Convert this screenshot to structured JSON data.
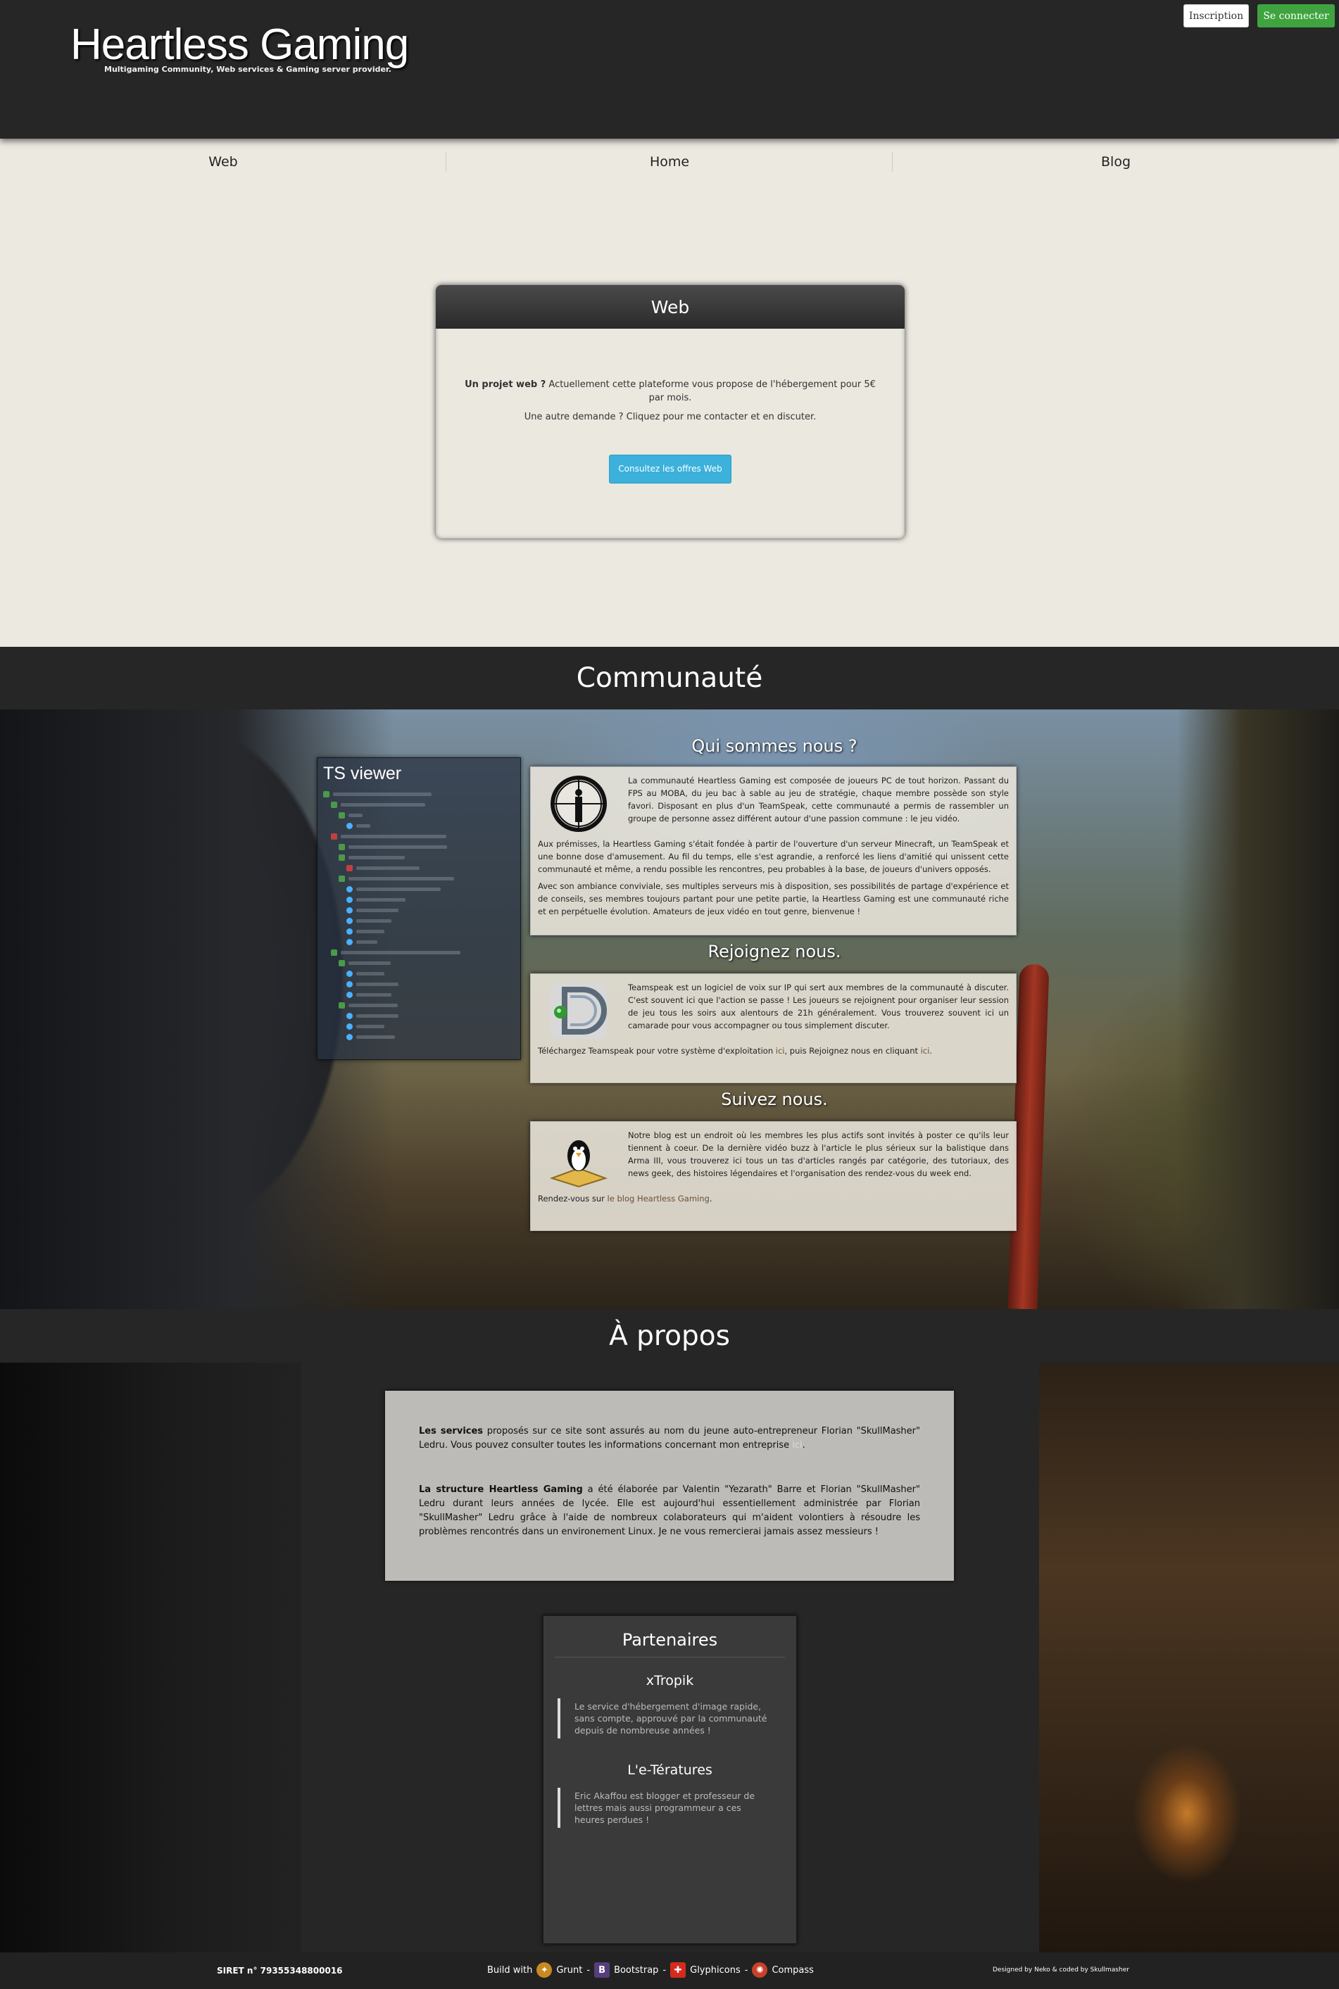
{
  "header": {
    "brand": "Heartless Gaming",
    "tagline": "Multigaming Community, Web services & Gaming server provider.",
    "signup_label": "Inscription",
    "login_label": "Se connecter"
  },
  "nav": {
    "items": [
      {
        "label": "Web"
      },
      {
        "label": "Home"
      },
      {
        "label": "Blog"
      }
    ]
  },
  "web": {
    "title": "Web",
    "line1_bold": "Un projet web ?",
    "line1": " Actuellement cette plateforme vous propose de l'hébergement pour 5€ par mois.",
    "line2": "Une autre demande ? Cliquez pour me contacter et en discuter.",
    "button_label": "Consultez les offres Web"
  },
  "community": {
    "title": "Communauté",
    "ts_viewer_title": "TS viewer",
    "about": {
      "title": "Qui sommes nous ?",
      "p1": "La communauté Heartless Gaming est composée de joueurs PC de tout horizon. Passant du FPS au MOBA, du jeu bac à sable au jeu de stratégie, chaque membre possède son style favori. Disposant en plus d'un TeamSpeak, cette communauté a permis de rassembler un groupe de personne assez différent autour d'une passion commune : le jeu vidéo.",
      "p2": "Aux prémisses, la Heartless Gaming s'était fondée à partir de l'ouverture d'un serveur Minecraft, un TeamSpeak et une bonne dose d'amusement. Au fil du temps, elle s'est agrandie, a renforcé les liens d'amitié qui unissent cette communauté et même, a rendu possible les rencontres, peu probables à la base, de joueurs d'univers opposés.",
      "p3": "Avec son ambiance conviviale, ses multiples serveurs mis à disposition, ses possibilités de partage d'expérience et de conseils, ses membres toujours partant pour une petite partie, la Heartless Gaming est une communauté riche et en perpétuelle évolution. Amateurs de jeux vidéo en tout genre, bienvenue !"
    },
    "join": {
      "title": "Rejoignez nous.",
      "p1": "Teamspeak est un logiciel de voix sur IP qui sert aux membres de la communauté à discuter. C'est souvent ici que l'action se passe ! Les joueurs se rejoignent pour organiser leur session de jeu tous les soirs aux alentours de 21h généralement. Vous trouverez souvent ici un camarade pour vous accompagner ou tous simplement discuter.",
      "p2a": "Téléchargez Teamspeak pour votre système d'exploitation ",
      "p2_link1": "ici",
      "p2b": ", puis Rejoignez nous en cliquant ",
      "p2_link2": "ici",
      "p2c": "."
    },
    "follow": {
      "title": "Suivez nous.",
      "p1": "Notre blog est un endroit où les membres les plus actifs sont invités à poster ce qu'ils leur tiennent à coeur. De la dernière vidéo buzz à l'article le plus sérieux sur la balistique dans Arma III, vous trouverez ici tous un tas d'articles rangés par catégorie, des tutoriaux, des news geek, des histoires légendaires et l'organisation des rendez-vous du week end.",
      "p2a": "Rendez-vous sur ",
      "p2_link": "le blog Heartless Gaming",
      "p2b": "."
    }
  },
  "apropos": {
    "title": "À propos",
    "p1_bold": "Les services",
    "p1": " proposés sur ce site sont assurés au nom du jeune auto-entrepreneur Florian \"SkullMasher\" Ledru. Vous pouvez consulter toutes les informations concernant mon entreprise ",
    "p1_link": "ici",
    "p1_end": ".",
    "p2_bold": "La structure Heartless Gaming",
    "p2": " a été élaborée par Valentin \"Yezarath\" Barre et Florian \"SkullMasher\" Ledru durant leurs années de lycée. Elle est aujourd'hui essentiellement administrée par Florian \"SkullMasher\" Ledru grâce à l'aide de nombreux colaborateurs qui m'aident volontiers à résoudre les problèmes rencontrés dans un environement Linux. Je ne vous remercierai jamais assez messieurs !",
    "partners_title": "Partenaires",
    "partners": [
      {
        "name": "xTropik",
        "desc": "Le service d'hébergement d'image rapide, sans compte, approuvé par la communauté depuis de nombreuse années !"
      },
      {
        "name": "L'e-Tératures",
        "desc": "Eric Akaffou est blogger et professeur de lettres mais aussi programmeur a ces heures perdues !"
      }
    ]
  },
  "footer": {
    "siret": "SIRET n° 79355348800016",
    "build_with": "Build with",
    "tools": [
      "Grunt",
      "Bootstrap",
      "Glyphicons",
      "Compass"
    ],
    "designed": "Designed by Neko & coded by Skullmasher"
  },
  "colors": {
    "login": "#3fa43f",
    "offers": "#3bb1db",
    "band": "#262626"
  }
}
